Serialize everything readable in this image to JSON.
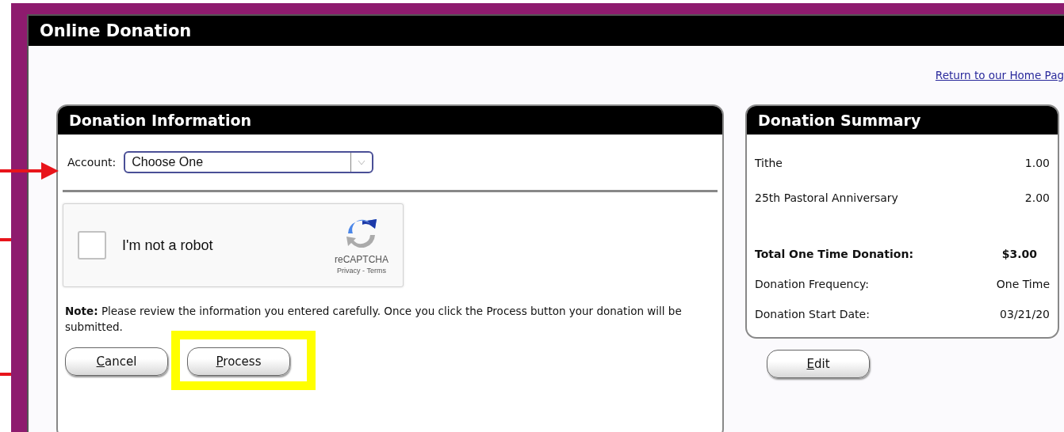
{
  "window": {
    "title": "Online Donation"
  },
  "home_link": "Return to our Home Pag",
  "donation_information": {
    "title": "Donation Information",
    "account": {
      "label": "Account:",
      "value": "Choose One"
    },
    "captcha": {
      "label": "I'm not a robot",
      "checked": false,
      "brand": "reCAPTCHA",
      "links": "Privacy - Terms"
    },
    "note": "**Note:** Please review the information you entered carefully. Once you click the Process button your donation will be submitted.",
    "buttons": [
      {
        "mnemonic": "C",
        "rest": "ancel",
        "highlighted": false
      },
      {
        "mnemonic": "P",
        "rest": "rocess",
        "highlighted": true
      }
    ]
  },
  "donation_summary": {
    "title": "Donation Summary",
    "rows": [
      {
        "kind": "item",
        "label": "Tithe",
        "value": "1.00"
      },
      {
        "kind": "item",
        "label": "25th Pastoral Anniversary",
        "value": "2.00"
      },
      {
        "kind": "total",
        "label": "Total One Time Donation:",
        "value": "$3.00"
      },
      {
        "kind": "detail",
        "label": "Donation Frequency:",
        "value": "One Time"
      },
      {
        "kind": "detail",
        "label": "Donation Start Date:",
        "value": "03/21/20"
      }
    ],
    "button": {
      "mnemonic": "E",
      "rest": "dit"
    }
  },
  "annotations": [
    {
      "kind": "arrow"
    },
    {
      "kind": "stub"
    },
    {
      "kind": "stub"
    }
  ]
}
